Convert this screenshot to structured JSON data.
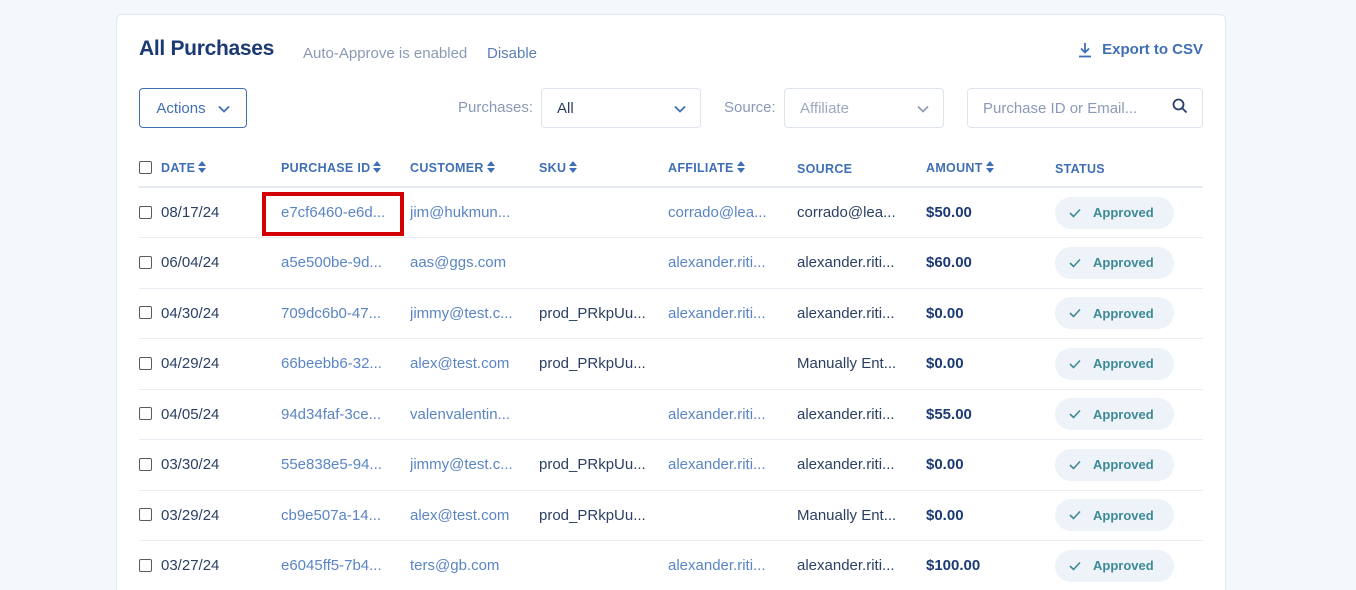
{
  "header": {
    "title": "All Purchases",
    "auto_approve_text": "Auto-Approve is enabled",
    "disable_label": "Disable",
    "export_label": "Export to CSV"
  },
  "toolbar": {
    "actions_label": "Actions",
    "purchases_label": "Purchases:",
    "purchases_value": "All",
    "source_label": "Source:",
    "source_placeholder": "Affiliate",
    "search_placeholder": "Purchase ID or Email..."
  },
  "table": {
    "columns": [
      "DATE",
      "PURCHASE ID",
      "CUSTOMER",
      "SKU",
      "AFFILIATE",
      "SOURCE",
      "AMOUNT",
      "STATUS"
    ],
    "rows": [
      {
        "date": "08/17/24",
        "purchase_id": "e7cf6460-e6d...",
        "customer": "jim@hukmun...",
        "sku": "",
        "affiliate": "corrado@lea...",
        "source": "corrado@lea...",
        "amount": "$50.00",
        "status": "Approved"
      },
      {
        "date": "06/04/24",
        "purchase_id": "a5e500be-9d...",
        "customer": "aas@ggs.com",
        "sku": "",
        "affiliate": "alexander.riti...",
        "source": "alexander.riti...",
        "amount": "$60.00",
        "status": "Approved"
      },
      {
        "date": "04/30/24",
        "purchase_id": "709dc6b0-47...",
        "customer": "jimmy@test.c...",
        "sku": "prod_PRkpUu...",
        "affiliate": "alexander.riti...",
        "source": "alexander.riti...",
        "amount": "$0.00",
        "status": "Approved"
      },
      {
        "date": "04/29/24",
        "purchase_id": "66beebb6-32...",
        "customer": "alex@test.com",
        "sku": "prod_PRkpUu...",
        "affiliate": "",
        "source": "Manually Ent...",
        "amount": "$0.00",
        "status": "Approved"
      },
      {
        "date": "04/05/24",
        "purchase_id": "94d34faf-3ce...",
        "customer": "valenvalentin...",
        "sku": "",
        "affiliate": "alexander.riti...",
        "source": "alexander.riti...",
        "amount": "$55.00",
        "status": "Approved"
      },
      {
        "date": "03/30/24",
        "purchase_id": "55e838e5-94...",
        "customer": "jimmy@test.c...",
        "sku": "prod_PRkpUu...",
        "affiliate": "alexander.riti...",
        "source": "alexander.riti...",
        "amount": "$0.00",
        "status": "Approved"
      },
      {
        "date": "03/29/24",
        "purchase_id": "cb9e507a-14...",
        "customer": "alex@test.com",
        "sku": "prod_PRkpUu...",
        "affiliate": "",
        "source": "Manually Ent...",
        "amount": "$0.00",
        "status": "Approved"
      },
      {
        "date": "03/27/24",
        "purchase_id": "e6045ff5-7b4...",
        "customer": "ters@gb.com",
        "sku": "",
        "affiliate": "alexander.riti...",
        "source": "alexander.riti...",
        "amount": "$100.00",
        "status": "Approved"
      }
    ]
  },
  "colors": {
    "brand": "#3f6fb5",
    "title": "#1b3a73",
    "link": "#5a85c4",
    "status_text": "#3d8a96",
    "status_bg": "#eef3f9",
    "highlight": "#d40000"
  },
  "icons": {
    "export": "download-icon",
    "actions": "chevron-down-icon",
    "search": "search-icon",
    "sort": "sort-icon",
    "status": "check-icon"
  }
}
